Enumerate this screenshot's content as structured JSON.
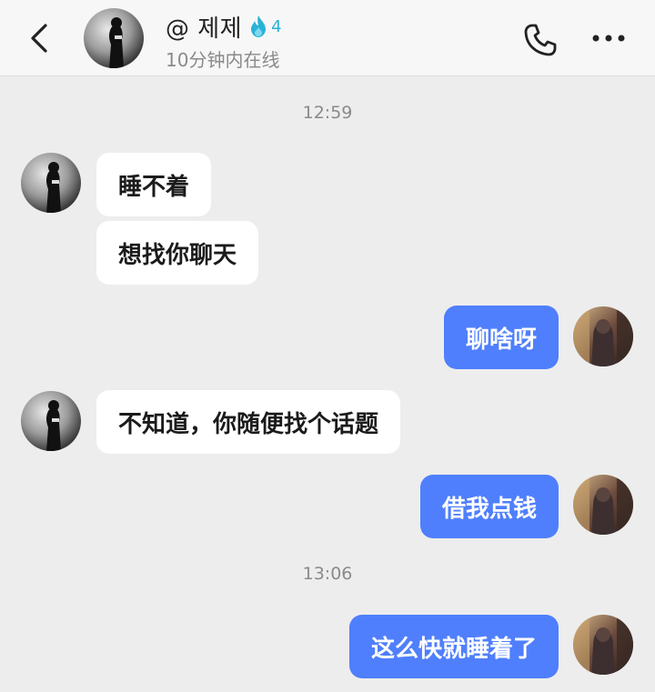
{
  "header": {
    "contact_name": "@ 제제",
    "streak_count": "4",
    "status": "10分钟内在线",
    "icons": {
      "back": "chevron-left-icon",
      "streak": "flame-icon",
      "call": "phone-icon",
      "more": "more-dots-icon"
    }
  },
  "timestamps": [
    "12:59",
    "13:06"
  ],
  "messages": [
    {
      "sender": "contact",
      "text": "睡不着"
    },
    {
      "sender": "contact",
      "text": "想找你聊天"
    },
    {
      "sender": "me",
      "text": "聊啥呀"
    },
    {
      "sender": "contact",
      "text": "不知道，你随便找个话题"
    },
    {
      "sender": "me",
      "text": "借我点钱"
    },
    {
      "sender": "me",
      "text": "这么快就睡着了"
    }
  ],
  "colors": {
    "outgoing_bubble": "#4f7ffc",
    "incoming_bubble": "#ffffff",
    "background": "#ededed",
    "streak": "#29b3d6"
  }
}
